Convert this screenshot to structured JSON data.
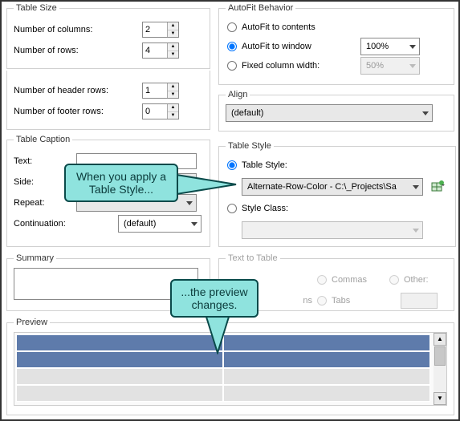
{
  "table_size": {
    "legend": "Table Size",
    "columns_label": "Number of columns:",
    "columns_value": "2",
    "rows_label": "Number of rows:",
    "rows_value": "4",
    "header_rows_label": "Number of header rows:",
    "header_rows_value": "1",
    "footer_rows_label": "Number of footer rows:",
    "footer_rows_value": "0"
  },
  "autofit": {
    "legend": "AutoFit Behavior",
    "contents_label": "AutoFit to contents",
    "window_label": "AutoFit to window",
    "fixed_label": "Fixed column width:",
    "window_value": "100%",
    "fixed_value": "50%",
    "selected": "window"
  },
  "align": {
    "legend": "Align",
    "value": "(default)"
  },
  "caption": {
    "legend": "Table Caption",
    "text_label": "Text:",
    "text_value": "",
    "side_label": "Side:",
    "side_value": "",
    "repeat_label": "Repeat:",
    "repeat_value": "",
    "continuation_label": "Continuation:",
    "continuation_value": "(default)"
  },
  "table_style": {
    "legend": "Table Style",
    "style_label": "Table Style:",
    "style_value": "Alternate-Row-Color - C:\\_Projects\\Sa",
    "class_label": "Style Class:",
    "class_value": "",
    "selected": "style"
  },
  "summary": {
    "legend": "Summary",
    "value": ""
  },
  "text_to_table": {
    "legend": "Text to Table",
    "commas_label": "Commas",
    "other_label": "Other:",
    "tabs_label": "Tabs",
    "other_value": "",
    "hidden_label_suffix": "ns"
  },
  "preview": {
    "legend": "Preview",
    "row_colors": [
      "#5e7bab",
      "#5e7bab",
      "#e2e2e2",
      "#e2e2e2"
    ]
  },
  "callouts": {
    "c1": "When you apply a Table Style...",
    "c2": "...the preview changes."
  }
}
